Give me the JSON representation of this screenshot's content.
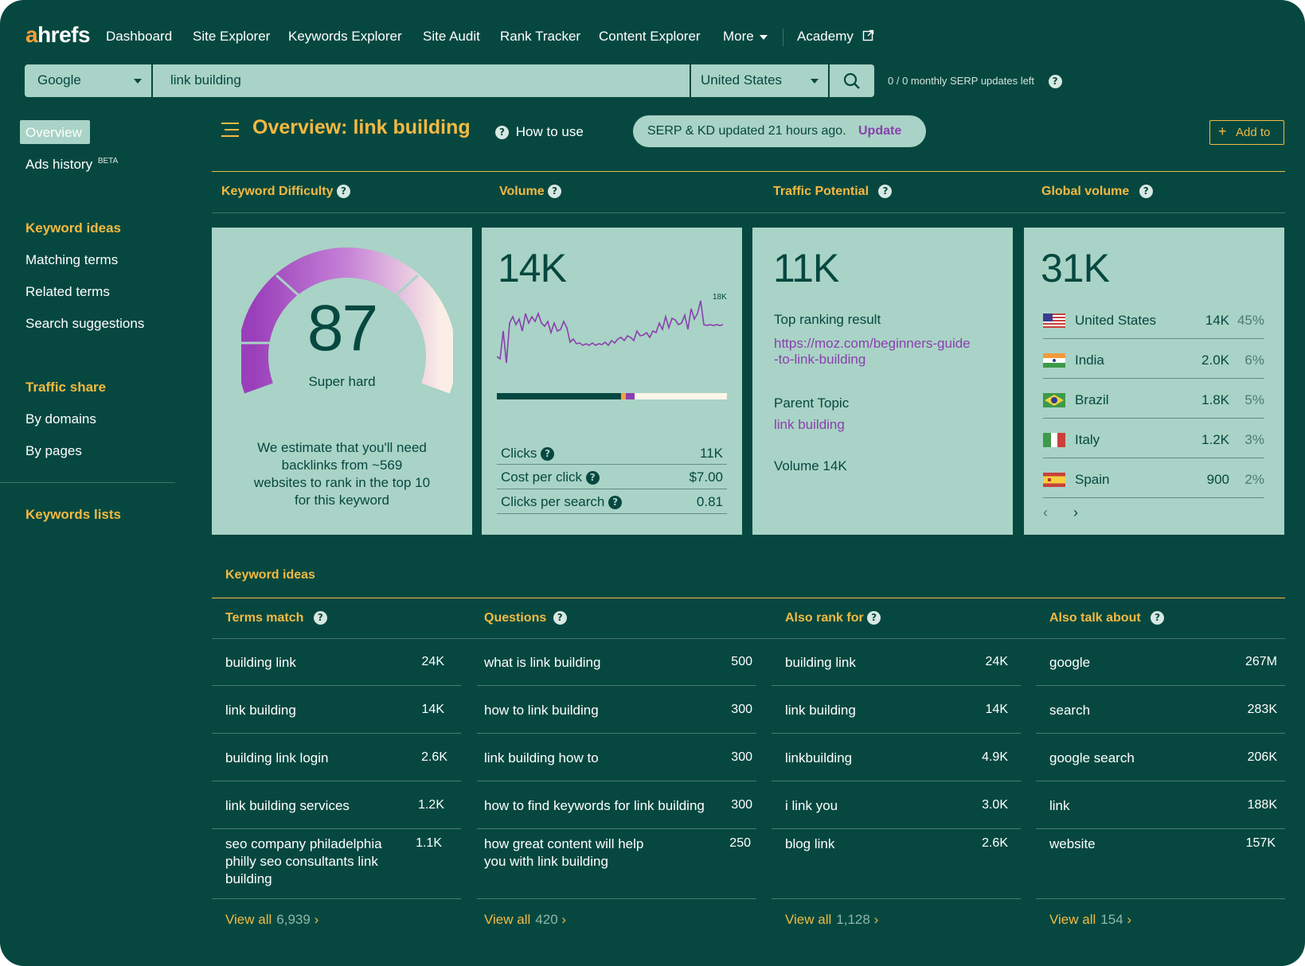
{
  "nav": {
    "logo": "ahrefs",
    "items": [
      "Dashboard",
      "Site Explorer",
      "Keywords Explorer",
      "Site Audit",
      "Rank Tracker",
      "Content Explorer",
      "More"
    ],
    "academy": "Academy"
  },
  "search": {
    "engine": "Google",
    "query": "link building",
    "country": "United States",
    "updates_left": "0 / 0 monthly SERP updates left"
  },
  "sidebar": {
    "overview": "Overview",
    "ads_history": "Ads history",
    "ads_badge": "BETA",
    "keyword_ideas_head": "Keyword ideas",
    "keyword_items": [
      "Matching terms",
      "Related terms",
      "Search suggestions"
    ],
    "traffic_head": "Traffic share",
    "traffic_items": [
      "By domains",
      "By pages"
    ],
    "lists_head": "Keywords lists"
  },
  "header": {
    "title": "Overview: link building",
    "how_to_use": "How to use",
    "serp_status": "SERP & KD updated 21 hours ago.",
    "update_link": "Update",
    "add_to": "Add to"
  },
  "metrics": {
    "kd_head": "Keyword Difficulty",
    "volume_head": "Volume",
    "tp_head": "Traffic Potential",
    "global_head": "Global volume"
  },
  "kd": {
    "value": "87",
    "score": 87,
    "label": "Super hard",
    "estimate": [
      "We estimate that you'll need",
      "backlinks from ~569",
      "websites to rank in the top 10",
      "for this keyword"
    ]
  },
  "volume": {
    "value": "14K",
    "peak_label": "18K",
    "clicks_label": "Clicks",
    "clicks": "11K",
    "cpc_label": "Cost per click",
    "cpc": "$7.00",
    "cps_label": "Clicks per search",
    "cps": "0.81",
    "clicks_bar": [
      {
        "color": "#064840",
        "share": 0.54
      },
      {
        "color": "#f4a13a",
        "share": 0.02
      },
      {
        "color": "#8b3fae",
        "share": 0.04
      },
      {
        "color": "#fdf6e8",
        "share": 0.4
      }
    ]
  },
  "traffic_potential": {
    "value": "11K",
    "top_result_label": "Top ranking result",
    "url_line1": "https://moz.com/beginners-guide",
    "url_line2": "-to-link-building",
    "parent_label": "Parent Topic",
    "parent_topic": "link building",
    "volume_text": "Volume 14K"
  },
  "global": {
    "value": "31K",
    "countries": [
      {
        "name": "United States",
        "vol": "14K",
        "pct": "45%"
      },
      {
        "name": "India",
        "vol": "2.0K",
        "pct": "6%"
      },
      {
        "name": "Brazil",
        "vol": "1.8K",
        "pct": "5%"
      },
      {
        "name": "Italy",
        "vol": "1.2K",
        "pct": "3%"
      },
      {
        "name": "Spain",
        "vol": "900",
        "pct": "2%"
      }
    ]
  },
  "ideas": {
    "head": "Keyword ideas",
    "columns": [
      {
        "title": "Terms match",
        "view_all": "View all",
        "count": "6,939",
        "rows": [
          [
            "building link",
            "24K"
          ],
          [
            "link building",
            "14K"
          ],
          [
            "building link login",
            "2.6K"
          ],
          [
            "link building services",
            "1.2K"
          ],
          [
            "seo company philadelphia philly seo consultants link building",
            "1.1K"
          ]
        ]
      },
      {
        "title": "Questions",
        "view_all": "View all",
        "count": "420",
        "rows": [
          [
            "what is link building",
            "500"
          ],
          [
            "how to link building",
            "300"
          ],
          [
            "link building how to",
            "300"
          ],
          [
            "how to find keywords for link building",
            "300"
          ],
          [
            "how great content will help you with link building",
            "250"
          ]
        ]
      },
      {
        "title": "Also rank for",
        "view_all": "View all",
        "count": "1,128",
        "rows": [
          [
            "building link",
            "24K"
          ],
          [
            "link building",
            "14K"
          ],
          [
            "linkbuilding",
            "4.9K"
          ],
          [
            "i link you",
            "3.0K"
          ],
          [
            "blog link",
            "2.6K"
          ]
        ]
      },
      {
        "title": "Also talk about",
        "view_all": "View all",
        "count": "154",
        "rows": [
          [
            "google",
            "267M"
          ],
          [
            "search",
            "283K"
          ],
          [
            "google search",
            "206K"
          ],
          [
            "link",
            "188K"
          ],
          [
            "website",
            "157K"
          ]
        ]
      }
    ]
  },
  "colors": {
    "background": "#064840",
    "card": "#a9d3c6",
    "accent_gold": "#f4b942",
    "accent_orange": "#f4a13a",
    "link_purple": "#8b3fae"
  }
}
